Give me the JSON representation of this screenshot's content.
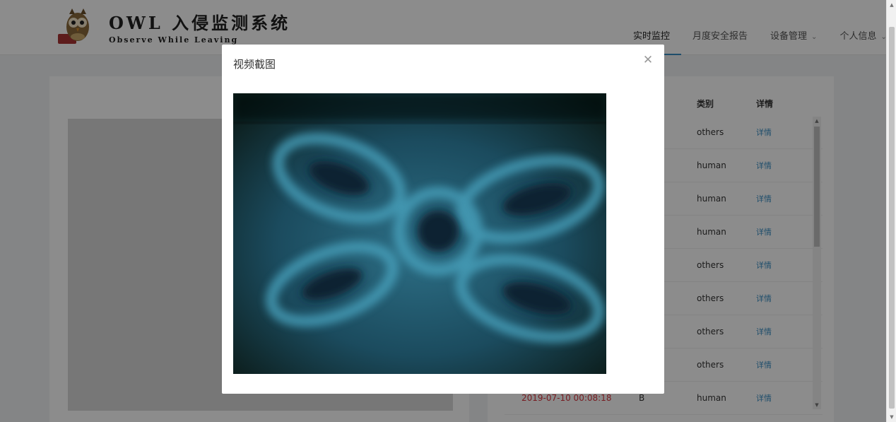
{
  "header": {
    "logo_title": "OWL 入侵监测系统",
    "logo_subtitle": "Observe While Leaving",
    "nav": [
      {
        "label": "实时监控",
        "active": true,
        "dropdown": false
      },
      {
        "label": "月度安全报告",
        "active": false,
        "dropdown": false
      },
      {
        "label": "设备管理",
        "active": false,
        "dropdown": true
      },
      {
        "label": "个人信息",
        "active": false,
        "dropdown": true
      }
    ]
  },
  "table": {
    "columns": [
      "",
      "别",
      "类别",
      "详情"
    ],
    "rows": [
      {
        "time": "",
        "level": "",
        "type": "others",
        "detail": "详情"
      },
      {
        "time": "",
        "level": "",
        "type": "human",
        "detail": "详情"
      },
      {
        "time": "",
        "level": "",
        "type": "human",
        "detail": "详情"
      },
      {
        "time": "",
        "level": "",
        "type": "human",
        "detail": "详情"
      },
      {
        "time": "",
        "level": "",
        "type": "others",
        "detail": "详情"
      },
      {
        "time": "",
        "level": "",
        "type": "others",
        "detail": "详情"
      },
      {
        "time": "",
        "level": "",
        "type": "others",
        "detail": "详情"
      },
      {
        "time": "",
        "level": "",
        "type": "others",
        "detail": "详情"
      },
      {
        "time": "2019-07-10 00:08:18",
        "level": "B",
        "type": "human",
        "detail": "详情"
      }
    ]
  },
  "modal": {
    "title": "视频截图",
    "close_icon": "close-icon",
    "image_description": "video-snapshot"
  },
  "colors": {
    "accent": "#3a8fc4",
    "alert_time": "#d9363e",
    "mask": "rgba(0,0,0,0.45)"
  }
}
